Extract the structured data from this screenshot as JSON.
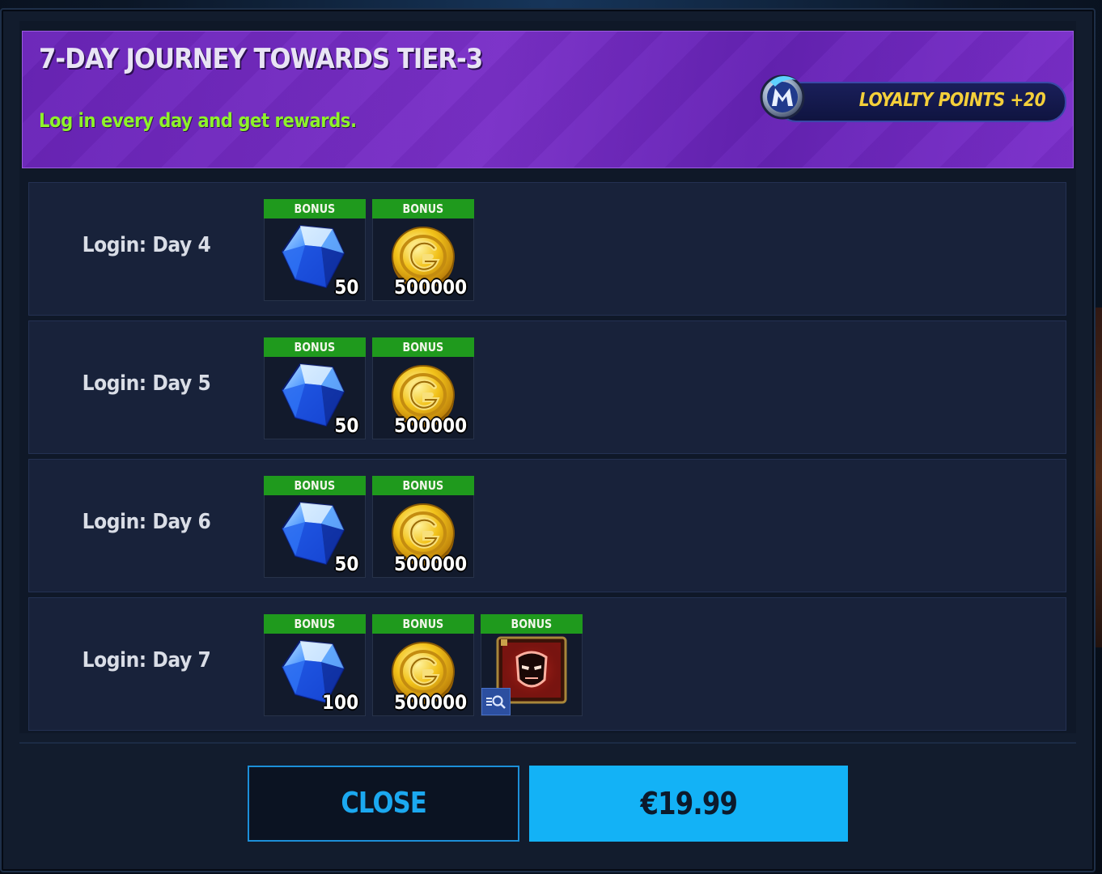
{
  "header": {
    "title": "7-DAY JOURNEY TOWARDS TIER-3",
    "subtitle": "Log in every day and get rewards.",
    "loyalty_label": "LOYALTY POINTS +20"
  },
  "colors": {
    "header_purple": "#7a30c8",
    "subtitle_green": "#8ef22a",
    "loyalty_gold": "#f4cf3a",
    "bonus_green": "#1f9a1d",
    "buy_blue": "#13b2f6"
  },
  "rows": [
    {
      "label": "Login: Day 4",
      "rewards": [
        {
          "badge": "BONUS",
          "icon": "crystal-icon",
          "qty": "50"
        },
        {
          "badge": "BONUS",
          "icon": "gold-coin-icon",
          "qty": "500000"
        }
      ]
    },
    {
      "label": "Login: Day 5",
      "rewards": [
        {
          "badge": "BONUS",
          "icon": "crystal-icon",
          "qty": "50"
        },
        {
          "badge": "BONUS",
          "icon": "gold-coin-icon",
          "qty": "500000"
        }
      ]
    },
    {
      "label": "Login: Day 6",
      "rewards": [
        {
          "badge": "BONUS",
          "icon": "crystal-icon",
          "qty": "50"
        },
        {
          "badge": "BONUS",
          "icon": "gold-coin-icon",
          "qty": "500000"
        }
      ]
    },
    {
      "label": "Login: Day 7",
      "rewards": [
        {
          "badge": "BONUS",
          "icon": "crystal-icon",
          "qty": "100"
        },
        {
          "badge": "BONUS",
          "icon": "gold-coin-icon",
          "qty": "500000"
        },
        {
          "badge": "BONUS",
          "icon": "iron-man-card-icon",
          "qty": ""
        }
      ]
    }
  ],
  "buttons": {
    "close": "CLOSE",
    "buy": "€19.99"
  }
}
